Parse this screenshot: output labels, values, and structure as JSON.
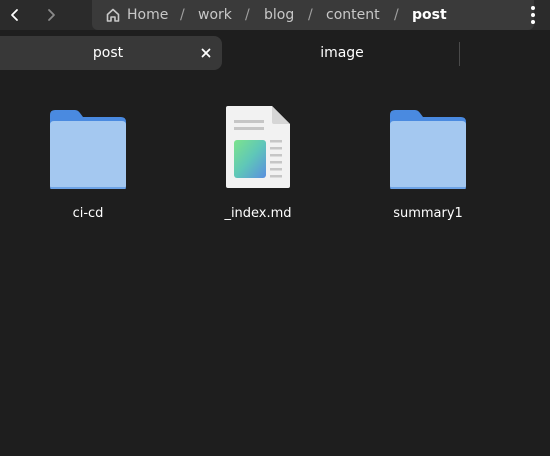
{
  "breadcrumb": {
    "home": "Home",
    "crumbs": [
      "work",
      "blog",
      "content"
    ],
    "current": "post",
    "separator": "/"
  },
  "tabs": [
    {
      "label": "post"
    },
    {
      "label": "image"
    }
  ],
  "files": [
    {
      "name": "ci-cd",
      "icon": "folder-icon"
    },
    {
      "name": "_index.md",
      "icon": "markdown-file-icon"
    },
    {
      "name": "summary1",
      "icon": "folder-icon"
    }
  ],
  "colors": {
    "folder": "#a4c8f0",
    "folder_tab": "#4a8ae0",
    "background": "#1e1e1e"
  }
}
